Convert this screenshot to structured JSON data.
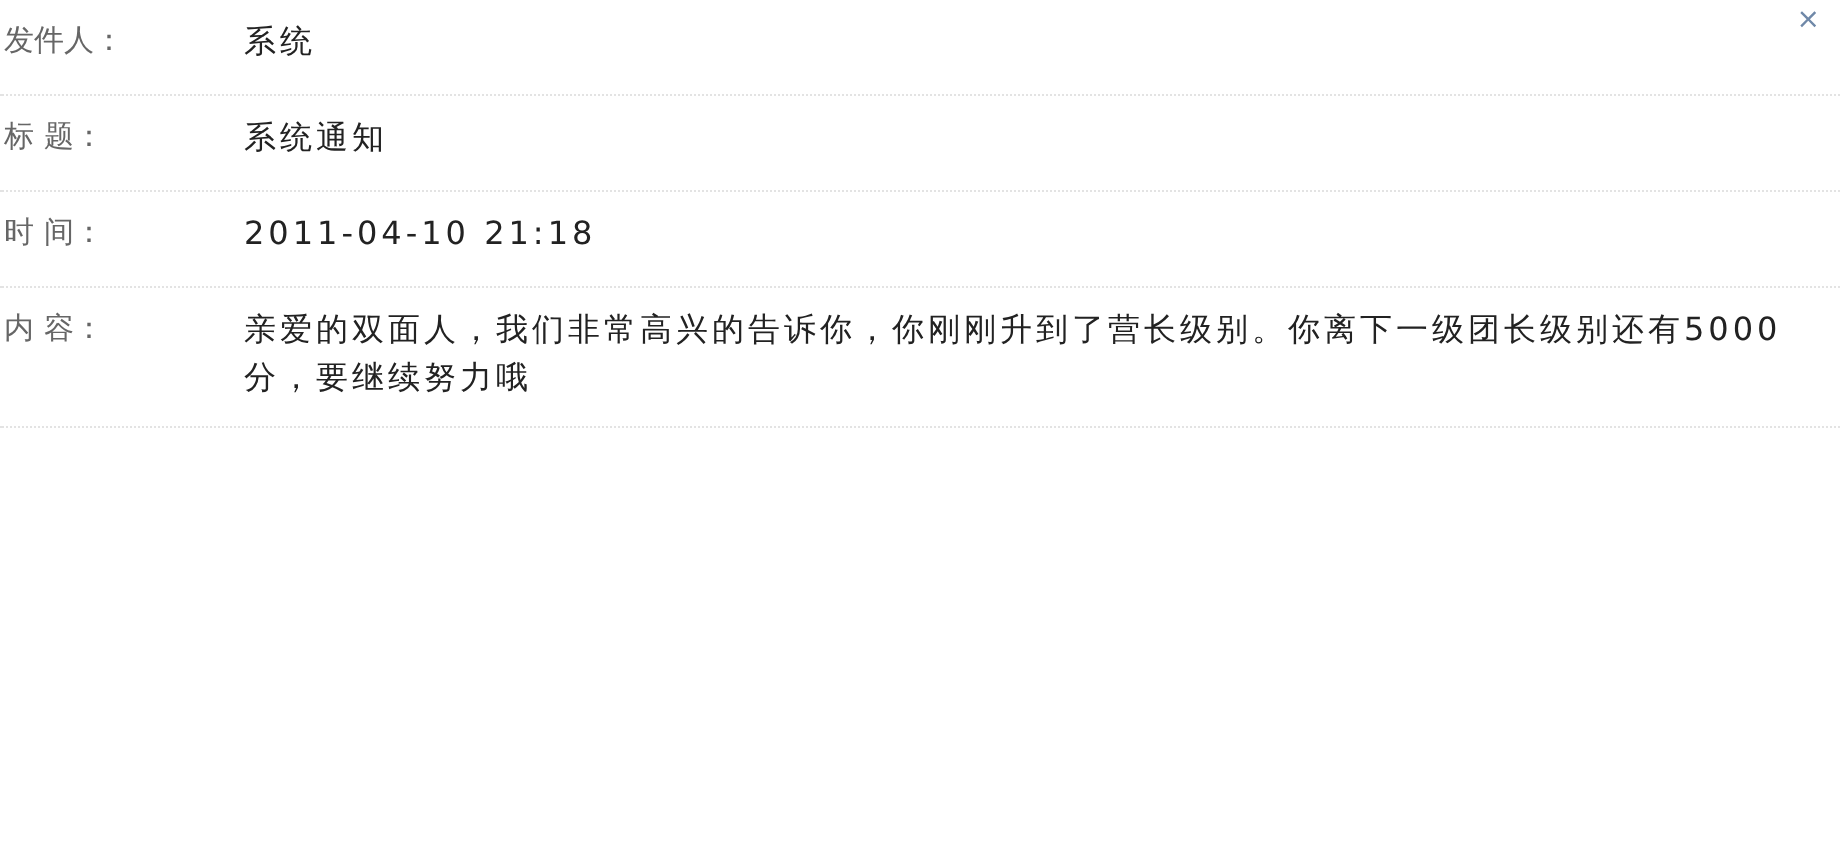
{
  "close_button": "×",
  "fields": [
    {
      "label": "发件人：",
      "value": "系统"
    },
    {
      "label": "标 题：",
      "value": "系统通知"
    },
    {
      "label": "时 间：",
      "value": "2011-04-10 21:18"
    },
    {
      "label": "内 容：",
      "value": "亲爱的双面人，我们非常高兴的告诉你，你刚刚升到了营长级别。你离下一级团长级别还有5000分，要继续努力哦"
    }
  ]
}
